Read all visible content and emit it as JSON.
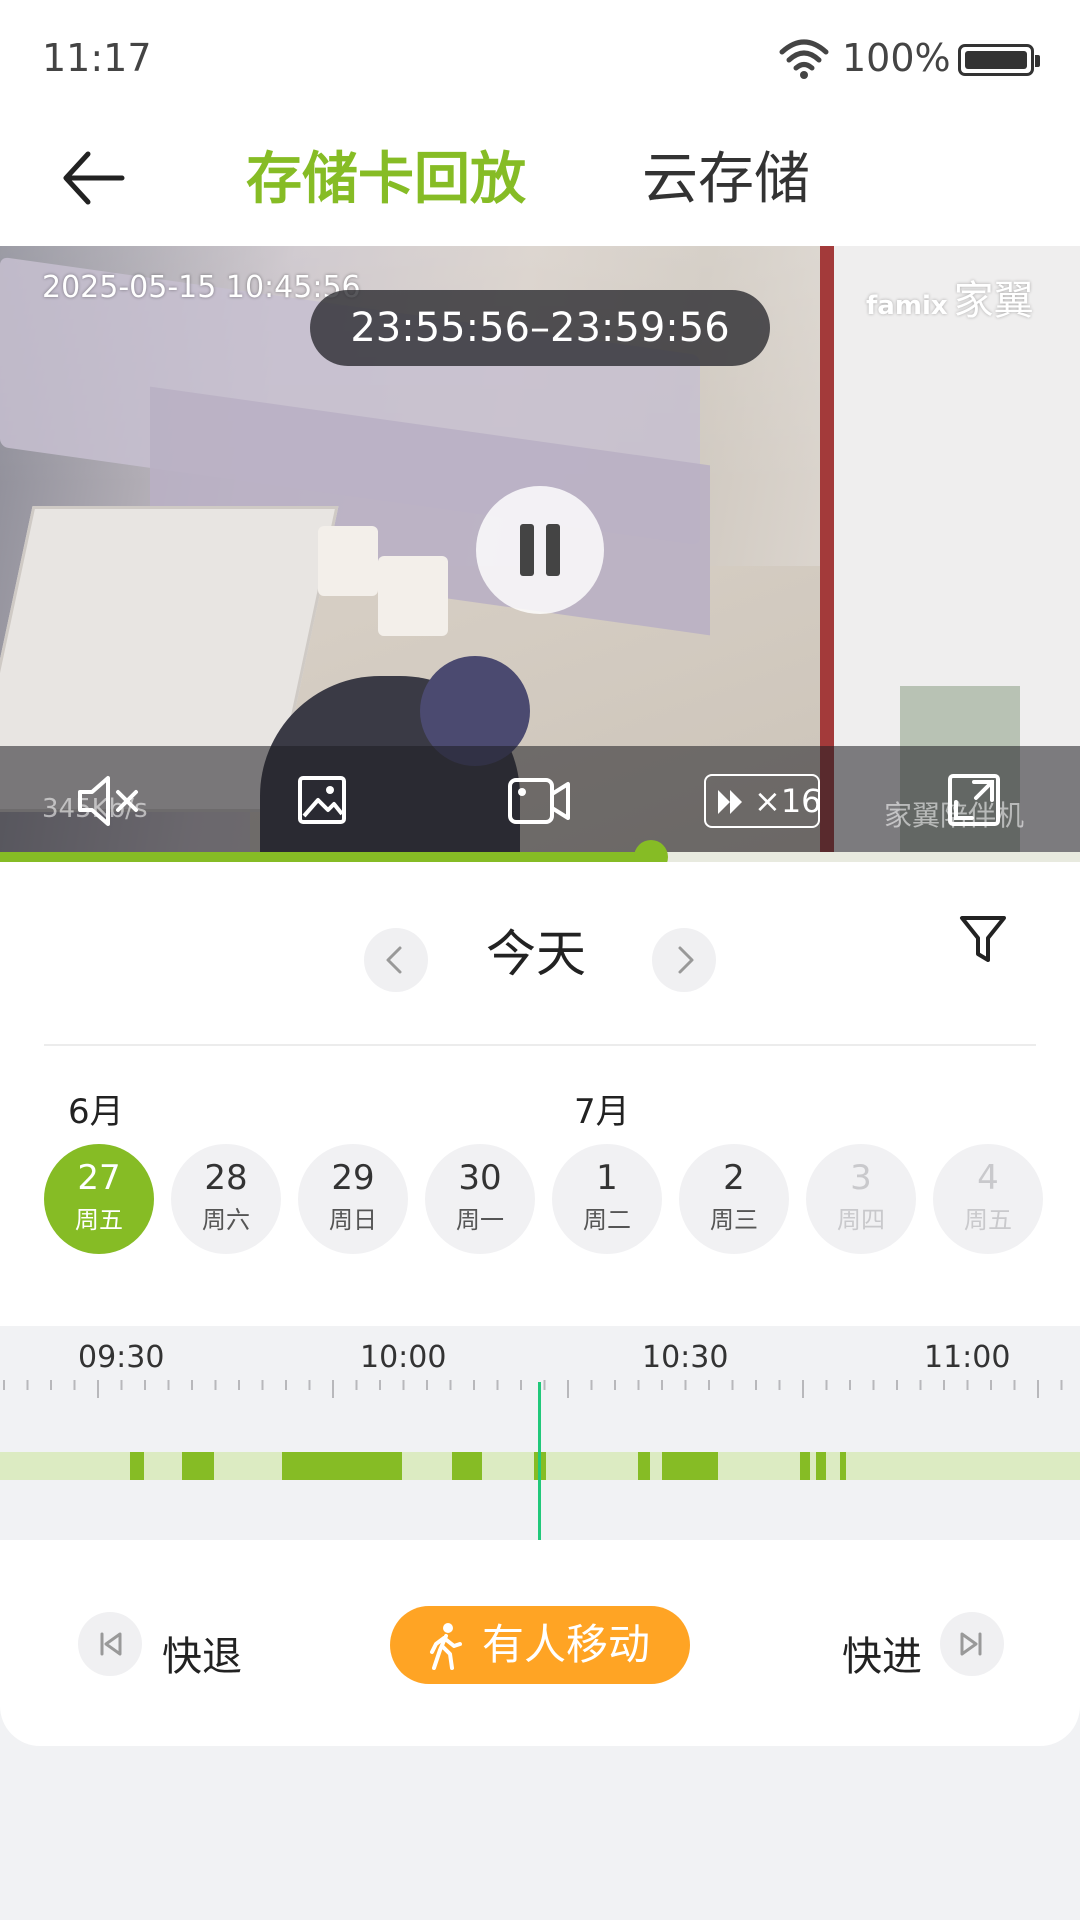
{
  "status_bar": {
    "time": "11:17",
    "battery_pct": "100%"
  },
  "header": {
    "tab_sd": "存储卡回放",
    "tab_cloud": "云存储"
  },
  "video": {
    "timestamp": "2025-05-15  10:45:56",
    "brand_small": "famix",
    "brand": "家翼",
    "range": "23:55:56–23:59:56",
    "bitrate": "345Kb/s",
    "camera_name": "家翼陪伴机",
    "speed": "×16",
    "progress": 0.6
  },
  "date_nav": {
    "label": "今天"
  },
  "calendar": {
    "months": [
      {
        "label": "6月"
      },
      {
        "label": "7月"
      }
    ],
    "days": [
      {
        "num": "27",
        "wk": "周五",
        "state": "active"
      },
      {
        "num": "28",
        "wk": "周六",
        "state": "normal"
      },
      {
        "num": "29",
        "wk": "周日",
        "state": "normal"
      },
      {
        "num": "30",
        "wk": "周一",
        "state": "normal"
      },
      {
        "num": "1",
        "wk": "周二",
        "state": "normal"
      },
      {
        "num": "2",
        "wk": "周三",
        "state": "normal"
      },
      {
        "num": "3",
        "wk": "周四",
        "state": "disabled"
      },
      {
        "num": "4",
        "wk": "周五",
        "state": "disabled"
      }
    ]
  },
  "timeline": {
    "labels": [
      "09:30",
      "10:00",
      "10:30",
      "11:00"
    ]
  },
  "controls": {
    "rewind": "快退",
    "forward": "快进",
    "motion": "有人移动"
  },
  "colors": {
    "accent": "#86bc25",
    "motion": "#ffa424",
    "cursor": "#21c87a"
  },
  "icons": [
    "back-arrow-icon",
    "wifi-icon",
    "battery-icon",
    "pause-icon",
    "mute-icon",
    "screenshot-icon",
    "record-icon",
    "fast-forward-icon",
    "fullscreen-icon",
    "chevron-left-icon",
    "chevron-right-icon",
    "filter-icon",
    "skip-back-icon",
    "skip-forward-icon",
    "walking-person-icon"
  ]
}
